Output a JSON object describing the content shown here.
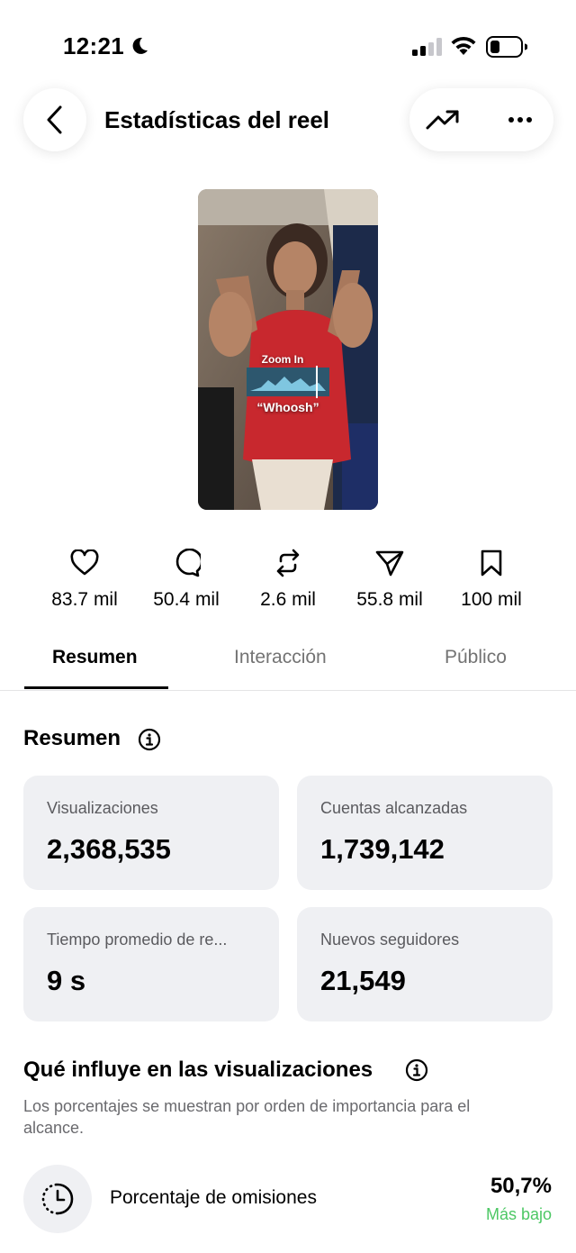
{
  "status_bar": {
    "time": "12:21"
  },
  "header": {
    "title": "Estadísticas del reel"
  },
  "reel": {
    "overlay_top": "Zoom In",
    "overlay_bottom": "“Whoosh”"
  },
  "stats": [
    {
      "icon": "heart-icon",
      "value": "83.7 mil"
    },
    {
      "icon": "comment-icon",
      "value": "50.4 mil"
    },
    {
      "icon": "repost-icon",
      "value": "2.6 mil"
    },
    {
      "icon": "share-icon",
      "value": "55.8 mil"
    },
    {
      "icon": "bookmark-icon",
      "value": "100 mil"
    }
  ],
  "tabs": [
    {
      "label": "Resumen",
      "active": true
    },
    {
      "label": "Interacción",
      "active": false
    },
    {
      "label": "Público",
      "active": false
    }
  ],
  "summary": {
    "title": "Resumen",
    "cards": [
      {
        "label": "Visualizaciones",
        "value": "2,368,535"
      },
      {
        "label": "Cuentas alcanzadas",
        "value": "1,739,142"
      },
      {
        "label": "Tiempo promedio de re...",
        "value": "9 s"
      },
      {
        "label": "Nuevos seguidores",
        "value": "21,549"
      }
    ]
  },
  "influence": {
    "title": "Qué influye en las visualizaciones",
    "description": "Los porcentajes se muestran por orden de importancia para el alcance.",
    "metrics": [
      {
        "icon": "clock-icon",
        "label": "Porcentaje de omisiones",
        "value": "50,7%",
        "note": "Más bajo",
        "note_color": "#4cc764"
      }
    ]
  }
}
